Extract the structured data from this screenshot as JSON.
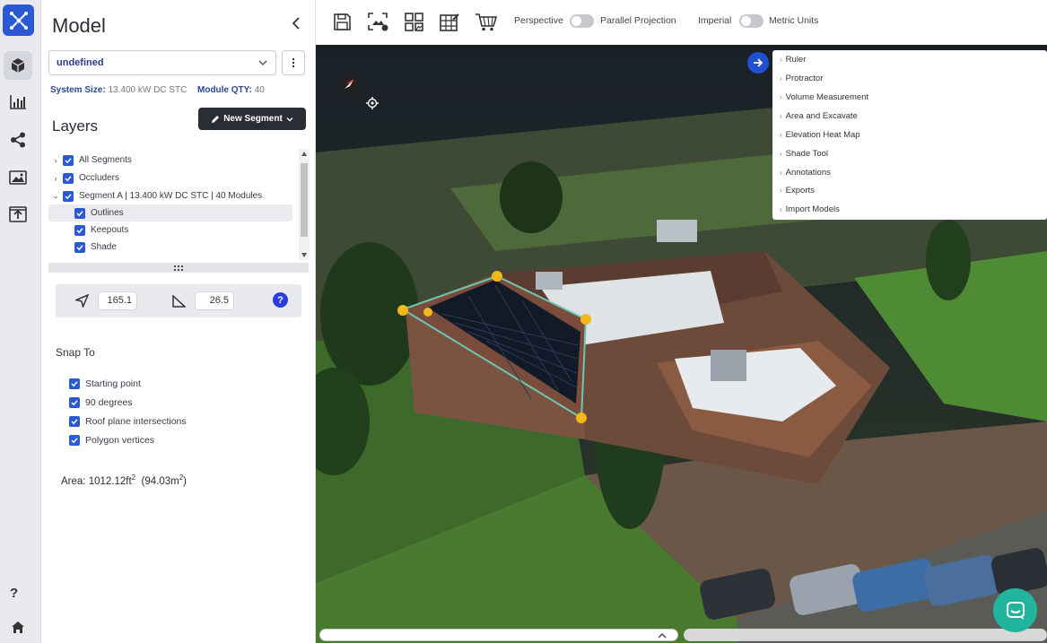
{
  "panel": {
    "title": "Model",
    "design_select": "undefined",
    "system_size_label": "System Size:",
    "system_size_value": "13.400 kW DC STC",
    "module_qty_label": "Module QTY:",
    "module_qty_value": "40",
    "layers_title": "Layers",
    "new_segment_label": "New Segment"
  },
  "layers": [
    {
      "label": "All Segments",
      "caret": "›",
      "checked": true
    },
    {
      "label": "Occluders",
      "caret": "›",
      "checked": true
    },
    {
      "label": "Segment A | 13.400 kW DC STC | 40 Modules",
      "caret": "⌄",
      "checked": true
    },
    {
      "label": "Outlines",
      "checked": true
    },
    {
      "label": "Keepouts",
      "checked": true
    },
    {
      "label": "Shade",
      "checked": true
    }
  ],
  "orientation": {
    "azimuth": "165.1",
    "tilt": "26.5",
    "help": "?"
  },
  "snap": {
    "title": "Snap To",
    "options": [
      "Starting point",
      "90 degrees",
      "Roof plane intersections",
      "Polygon vertices"
    ]
  },
  "area": {
    "label": "Area:",
    "ft_value": "1012.12ft",
    "ft_exp": "2",
    "m_value": "(94.03m",
    "m_exp": "2",
    "m_close": ")"
  },
  "rail": {
    "help": "?",
    "icons": [
      "model-cube-icon",
      "bar-chart-icon",
      "share-icon",
      "images-icon",
      "upload-icon",
      "home-icon"
    ]
  },
  "toolbar": {
    "icons": [
      "save-icon",
      "screenshot-icon",
      "layout-grid-icon",
      "grid-edit-icon",
      "cart-icon"
    ],
    "perspective": "Perspective",
    "parallel": "Parallel Projection",
    "imperial": "Imperial",
    "metric": "Metric Units"
  },
  "tools": [
    "Ruler",
    "Protractor",
    "Volume Measurement",
    "Area and Excavate",
    "Elevation Heat Map",
    "Shade Tool",
    "Annotations",
    "Exports",
    "Import Models"
  ],
  "colors": {
    "accent": "#2b59d6",
    "dark_button": "#2b2d35",
    "chat": "#22b59e",
    "vertex": "#f2b81c"
  }
}
